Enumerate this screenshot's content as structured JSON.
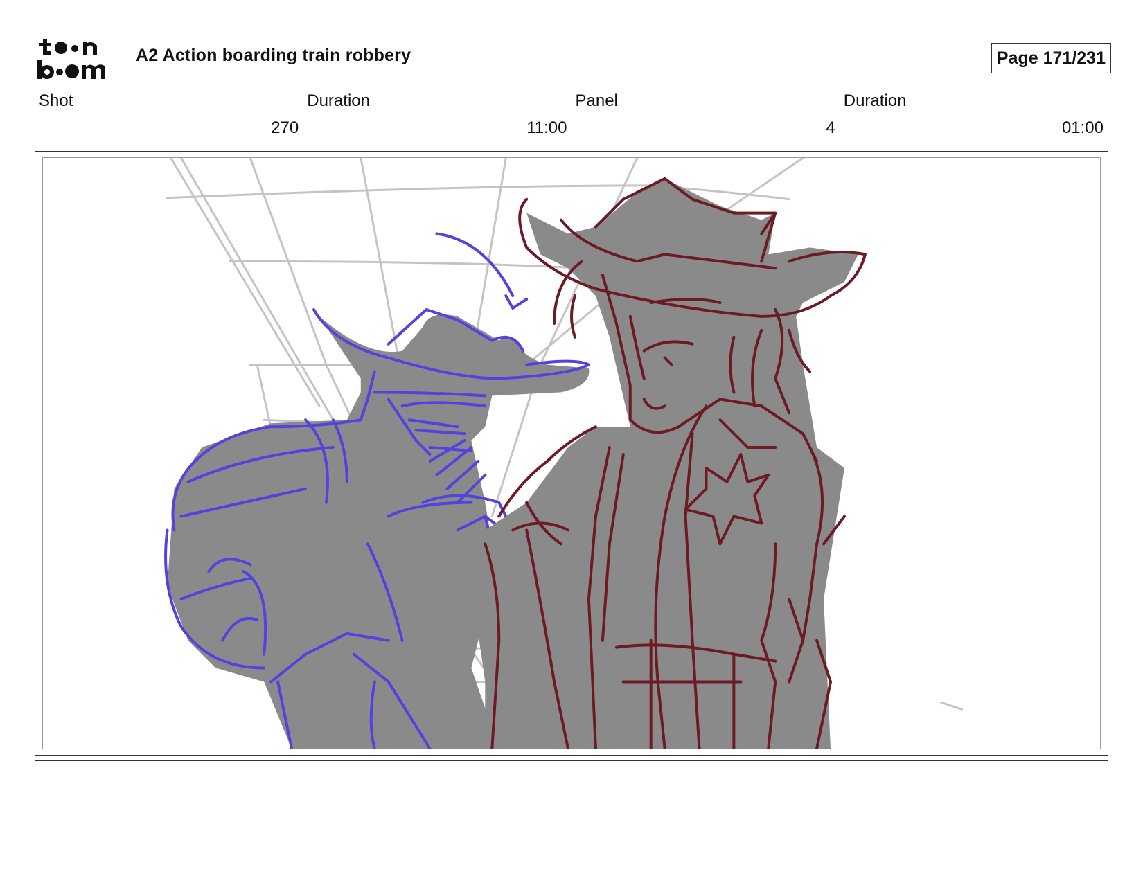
{
  "header": {
    "logo_text": "toonboom",
    "title": "A2 Action boarding train robbery",
    "page": "Page 171/231"
  },
  "info": {
    "shot_label": "Shot",
    "shot_value": "270",
    "shot_duration_label": "Duration",
    "shot_duration_value": "11:00",
    "panel_label": "Panel",
    "panel_value": "4",
    "panel_duration_label": "Duration",
    "panel_duration_value": "01:00"
  },
  "notes": {
    "text": ""
  },
  "colors": {
    "outlaw_line": "#5242e0",
    "sheriff_line": "#6e1a25",
    "fill_gray": "#8a8a8a",
    "background_line": "#c4c4c4"
  }
}
